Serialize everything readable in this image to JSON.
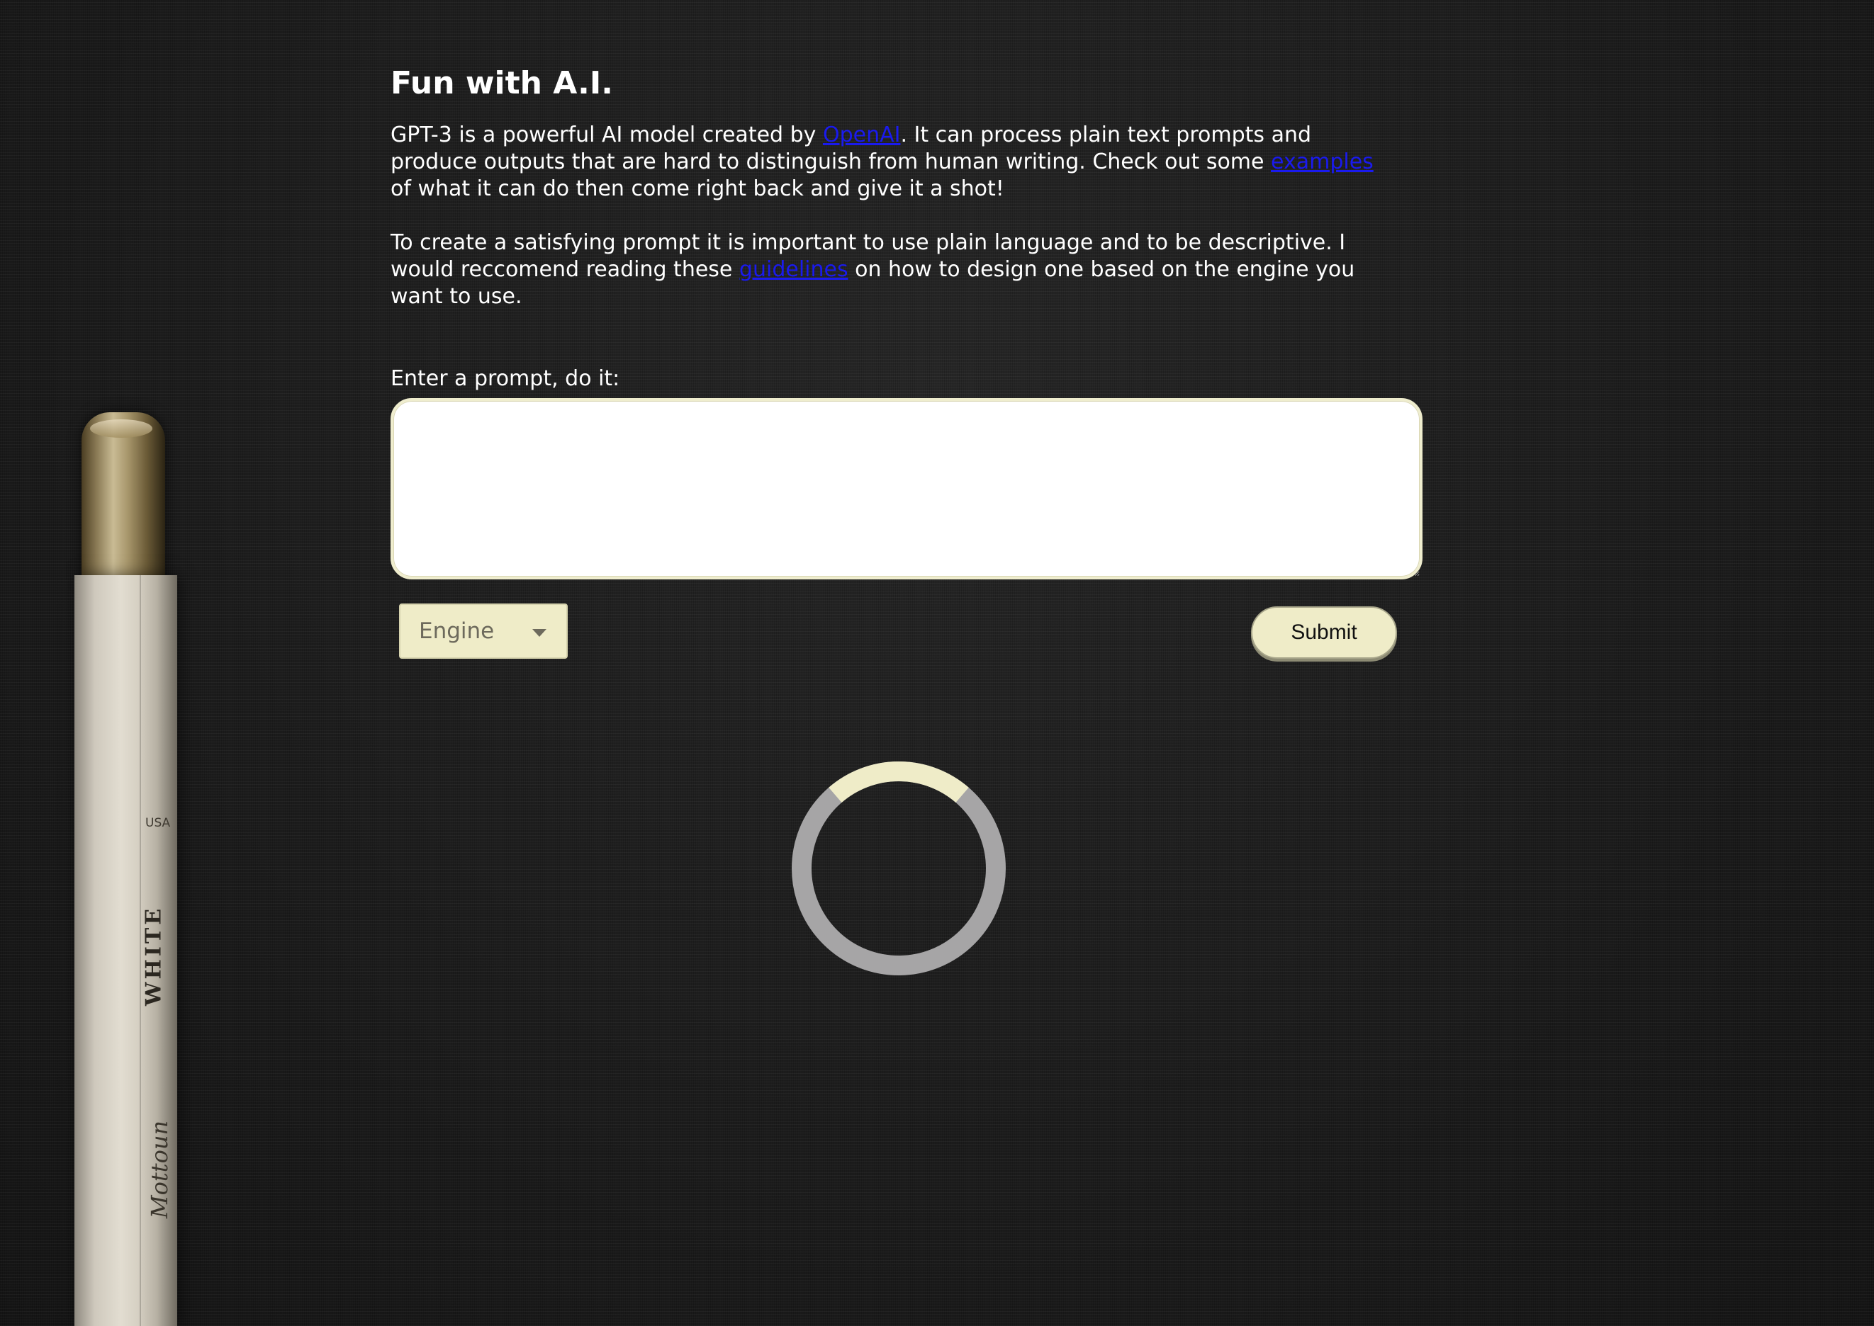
{
  "header": {
    "title": "Fun with A.I."
  },
  "intro": {
    "p1_before_link1": "GPT-3 is a powerful AI model created by ",
    "p1_link1": "OpenAI",
    "p1_between_links": ". It can process plain text prompts and produce outputs that are hard to distinguish from human writing. Check out some ",
    "p1_link2": "examples",
    "p1_after_link2": " of what it can do then come right back and give it a shot!",
    "p2_before_link": "To create a satisfying prompt it is important to use plain language and to be descriptive. I would reccomend reading these ",
    "p2_link": "guidelines",
    "p2_after_link": " on how to design one based on the engine you want to use."
  },
  "form": {
    "prompt_label": "Enter a prompt, do it:",
    "prompt_value": "",
    "engine_label": "Engine",
    "submit_label": "Submit"
  },
  "colors": {
    "accent": "#efecc8",
    "link": "#1a1aee",
    "spinner_track": "#a6a5a6",
    "background": "#1c1c1c"
  },
  "pencil": {
    "brand_text": "WHITE",
    "script_text": "Mottoun",
    "origin_text": "USA"
  },
  "icons": {
    "dropdown": "chevron-down-icon",
    "spinner": "loading-spinner"
  }
}
